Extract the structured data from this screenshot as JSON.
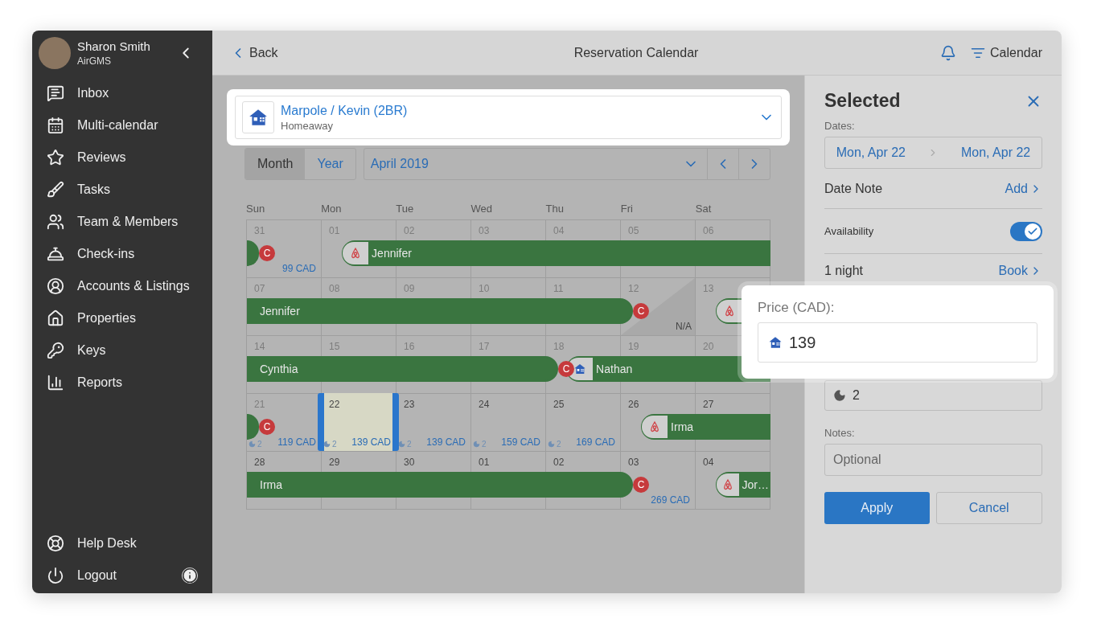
{
  "user": {
    "name": "Sharon Smith",
    "company": "AirGMS"
  },
  "nav": [
    {
      "label": "Inbox"
    },
    {
      "label": "Multi-calendar"
    },
    {
      "label": "Reviews"
    },
    {
      "label": "Tasks"
    },
    {
      "label": "Team & Members"
    },
    {
      "label": "Check-ins"
    },
    {
      "label": "Accounts & Listings"
    },
    {
      "label": "Properties"
    },
    {
      "label": "Keys"
    },
    {
      "label": "Reports"
    }
  ],
  "nav_bottom": [
    {
      "label": "Help Desk"
    },
    {
      "label": "Logout"
    }
  ],
  "header": {
    "back": "Back",
    "title": "Reservation Calendar",
    "view": "Calendar"
  },
  "property": {
    "name": "Marpole / Kevin (2BR)",
    "channel": "Homeaway"
  },
  "view_tabs": [
    {
      "label": "Month",
      "selected": true
    },
    {
      "label": "Year",
      "selected": false
    }
  ],
  "month": "April 2019",
  "weekdays": [
    "Sun",
    "Mon",
    "Tue",
    "Wed",
    "Thu",
    "Fri",
    "Sat"
  ],
  "weeks": [
    {
      "days": [
        {
          "date": "31",
          "past": true,
          "price": "99 CAD",
          "badge": "C",
          "selected": false
        },
        {
          "date": "01",
          "past": true,
          "checkin": {
            "guest": "Jennifer",
            "kind": "airbnb"
          },
          "selected": false
        },
        {
          "date": "02",
          "past": true,
          "selected": false
        },
        {
          "date": "03",
          "past": true,
          "selected": false
        },
        {
          "date": "04",
          "past": true,
          "selected": false
        },
        {
          "date": "05",
          "past": true,
          "selected": false
        },
        {
          "date": "06",
          "past": true,
          "selected": false
        }
      ]
    },
    {
      "days": [
        {
          "date": "07",
          "past": true,
          "selected": false
        },
        {
          "date": "08",
          "past": true,
          "selected": false
        },
        {
          "date": "09",
          "past": true,
          "selected": false
        },
        {
          "date": "10",
          "past": true,
          "selected": false
        },
        {
          "date": "11",
          "past": true,
          "selected": false
        },
        {
          "date": "12",
          "past": true,
          "badge": "C",
          "selected": false,
          "blocked": true,
          "note": "N/A"
        },
        {
          "date": "13",
          "past": true,
          "checkin": {
            "kind": "airbnb"
          },
          "selected": false
        }
      ],
      "continued": {
        "guest": "Jennifer"
      }
    },
    {
      "days": [
        {
          "date": "14",
          "past": true,
          "selected": false
        },
        {
          "date": "15",
          "past": true,
          "selected": false
        },
        {
          "date": "16",
          "past": true,
          "selected": false
        },
        {
          "date": "17",
          "past": true,
          "selected": false
        },
        {
          "date": "18",
          "past": true,
          "badge": "C",
          "checkin": {
            "guest": "Nathan",
            "kind": "homeaway"
          },
          "selected": false
        },
        {
          "date": "19",
          "past": true,
          "selected": false
        },
        {
          "date": "20",
          "past": true,
          "selected": false
        }
      ],
      "continued": {
        "guest": "Cynthia"
      }
    },
    {
      "days": [
        {
          "date": "21",
          "past": true,
          "nights": "2",
          "price": "119 CAD",
          "badge": "C",
          "selected": false
        },
        {
          "date": "22",
          "past": false,
          "nights": "2",
          "price": "139 CAD",
          "selected": true
        },
        {
          "date": "23",
          "past": false,
          "nights": "2",
          "price": "139 CAD",
          "selected": false
        },
        {
          "date": "24",
          "past": false,
          "nights": "2",
          "price": "159 CAD",
          "selected": false
        },
        {
          "date": "25",
          "past": false,
          "nights": "2",
          "price": "169 CAD",
          "selected": false
        },
        {
          "date": "26",
          "past": false,
          "checkin": {
            "guest": "Irma",
            "kind": "airbnb"
          },
          "selected": false
        },
        {
          "date": "27",
          "past": false,
          "selected": false
        }
      ]
    },
    {
      "days": [
        {
          "date": "28",
          "past": false,
          "selected": false
        },
        {
          "date": "29",
          "past": false,
          "selected": false
        },
        {
          "date": "30",
          "past": false,
          "selected": false
        },
        {
          "date": "01",
          "past": false,
          "selected": false
        },
        {
          "date": "02",
          "past": false,
          "selected": false
        },
        {
          "date": "03",
          "past": false,
          "price": "269 CAD",
          "badge": "C",
          "selected": false
        },
        {
          "date": "04",
          "past": false,
          "checkin": {
            "guest": "Jor…",
            "kind": "airbnb"
          },
          "selected": false
        }
      ],
      "continued": {
        "guest": "Irma"
      }
    }
  ],
  "panel": {
    "title": "Selected",
    "dates_label": "Dates:",
    "date_from": "Mon, Apr 22",
    "date_to": "Mon, Apr 22",
    "date_note": {
      "label": "Date Note",
      "action": "Add"
    },
    "availability": {
      "label": "Availability",
      "on": true
    },
    "stay": {
      "label": "1 night",
      "action": "Book"
    },
    "nights": "2",
    "notes_label": "Notes:",
    "notes_placeholder": "Optional",
    "apply": "Apply",
    "cancel": "Cancel"
  },
  "price_popup": {
    "label": "Price (CAD):",
    "value": "139"
  }
}
